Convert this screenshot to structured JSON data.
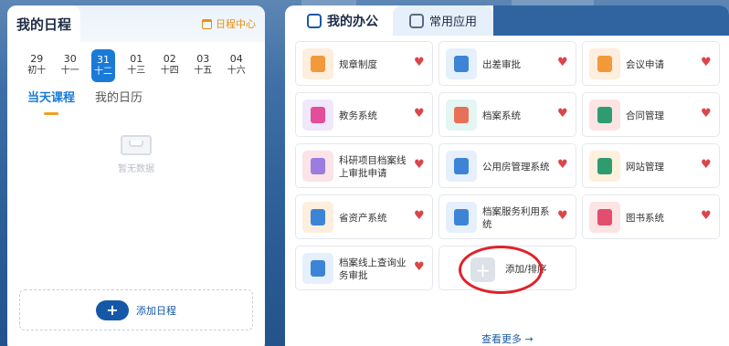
{
  "left": {
    "title": "我的日程",
    "schedule_center": "日程中心",
    "days": [
      {
        "num": "29",
        "lunar": "初十",
        "active": false
      },
      {
        "num": "30",
        "lunar": "十一",
        "active": false
      },
      {
        "num": "31",
        "lunar": "十二",
        "active": true
      },
      {
        "num": "01",
        "lunar": "十三",
        "active": false
      },
      {
        "num": "02",
        "lunar": "十四",
        "active": false
      },
      {
        "num": "03",
        "lunar": "十五",
        "active": false
      },
      {
        "num": "04",
        "lunar": "十六",
        "active": false
      }
    ],
    "tabs": [
      "当天课程",
      "我的日历"
    ],
    "empty_text": "暂无数据",
    "add_label": "添加日程",
    "add_icon": "+"
  },
  "right": {
    "tabs": [
      "我的办公",
      "常用应用"
    ],
    "apps": [
      {
        "label": "规章制度",
        "icon": "document-icon",
        "bg": "#fdeedd",
        "fg": "#f29a3a"
      },
      {
        "label": "出差审批",
        "icon": "invoice-icon",
        "bg": "#e6f0fc",
        "fg": "#3d84d6"
      },
      {
        "label": "会议申请",
        "icon": "meeting-icon",
        "bg": "#fdeedd",
        "fg": "#f29a3a"
      },
      {
        "label": "教务系统",
        "icon": "books-icon",
        "bg": "#efe8fb",
        "fg": "#e34d9a"
      },
      {
        "label": "档案系统",
        "icon": "archive-box-icon",
        "bg": "#e3f6f1",
        "fg": "#e8705a"
      },
      {
        "label": "合同管理",
        "icon": "contract-icon",
        "bg": "#fde4e4",
        "fg": "#2f9c6f"
      },
      {
        "label": "科研项目档案线上审批申请",
        "icon": "research-doc-icon",
        "bg": "#fbe3e8",
        "fg": "#9b7ce0"
      },
      {
        "label": "公用房管理系统",
        "icon": "building-icon",
        "bg": "#e6f0fc",
        "fg": "#3d84d6"
      },
      {
        "label": "网站管理",
        "icon": "monitor-gear-icon",
        "bg": "#fdf0dd",
        "fg": "#2f9c6f"
      },
      {
        "label": "省资产系统",
        "icon": "layout-icon",
        "bg": "#fdeedd",
        "fg": "#3d84d6"
      },
      {
        "label": "档案服务利用系统",
        "icon": "clipboard-icon",
        "bg": "#e6f0fc",
        "fg": "#3d84d6"
      },
      {
        "label": "图书系统",
        "icon": "book-icon",
        "bg": "#fde4e4",
        "fg": "#e34d70"
      },
      {
        "label": "档案线上查询业务审批",
        "icon": "search-doc-icon",
        "bg": "#e6f0fc",
        "fg": "#3d84d6"
      }
    ],
    "add_sort": "添加/排序",
    "more": "查看更多 →"
  }
}
